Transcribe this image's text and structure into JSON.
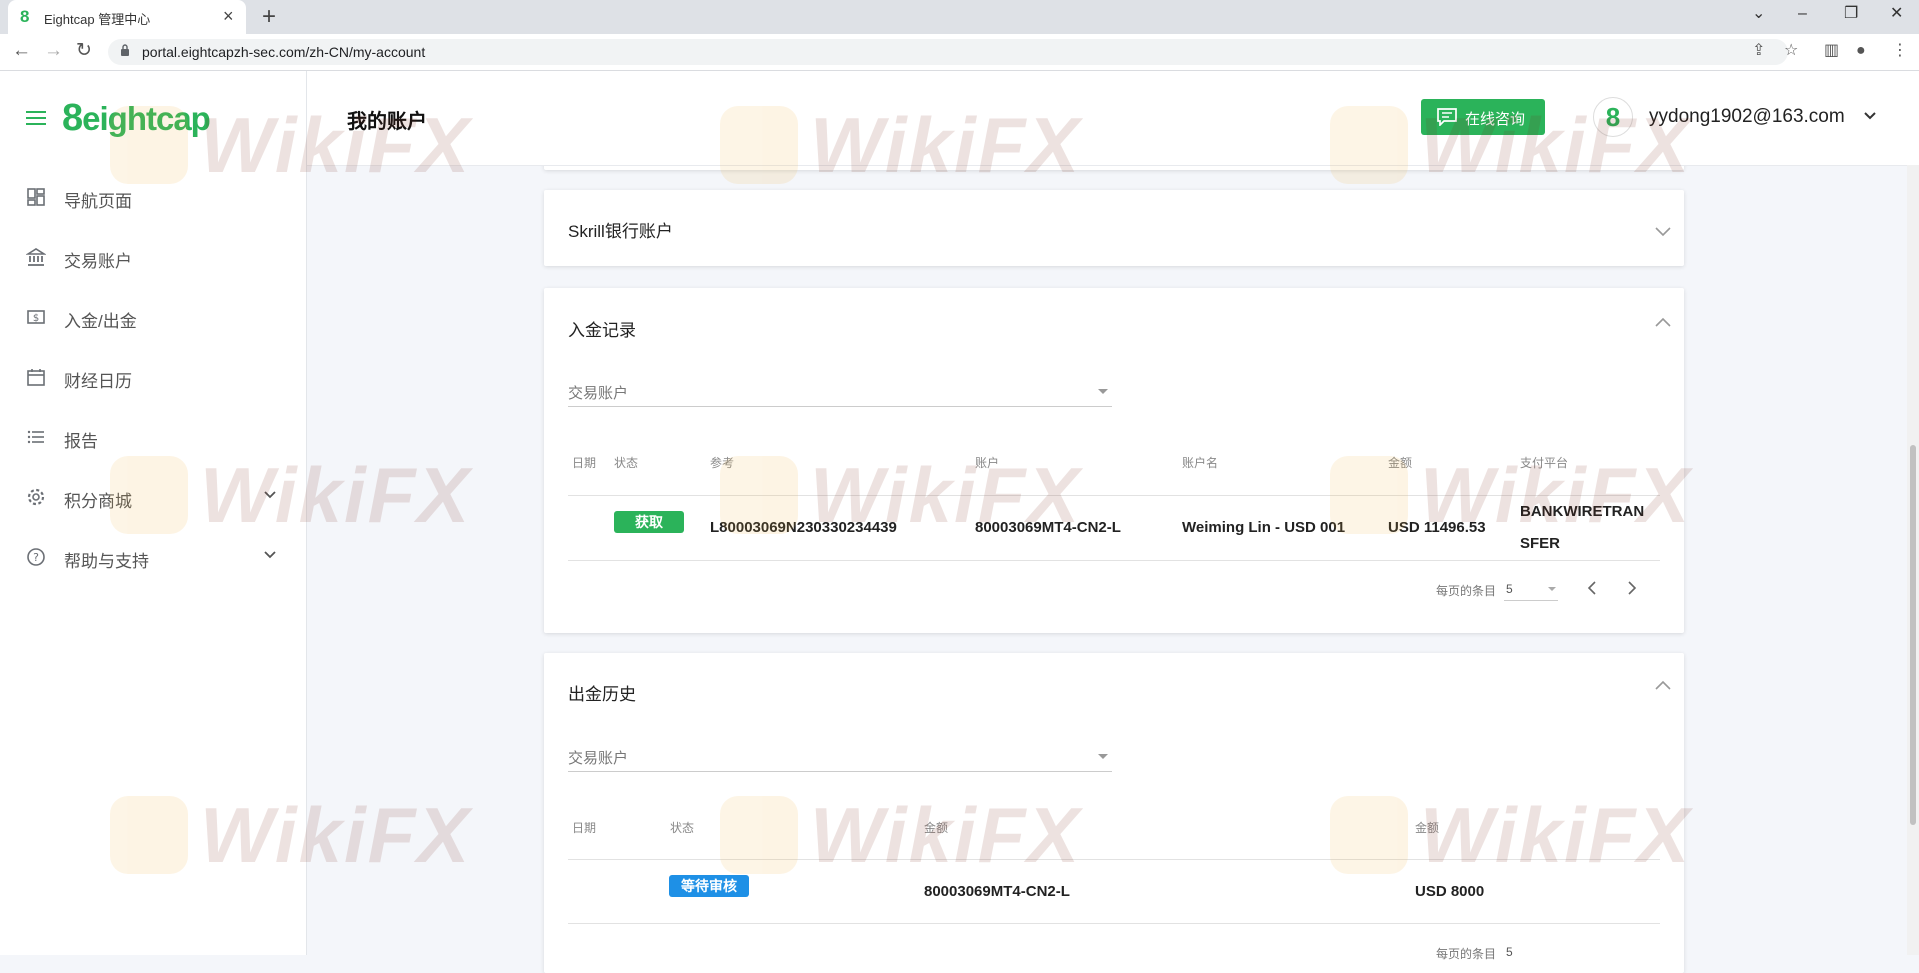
{
  "browser": {
    "tab_title": "Eightcap 管理中心",
    "url": "portal.eightcapzh-sec.com/zh-CN/my-account"
  },
  "brand": {
    "logo_text": "eightcap",
    "logo_digit": "8",
    "accent": "#2bb35a"
  },
  "sidebar": {
    "items": [
      {
        "label": "导航页面",
        "icon": "dashboard-grid-icon"
      },
      {
        "label": "交易账户",
        "icon": "bank-icon"
      },
      {
        "label": "入金/出金",
        "icon": "money-icon"
      },
      {
        "label": "财经日历",
        "icon": "calendar-icon"
      },
      {
        "label": "报告",
        "icon": "list-icon"
      },
      {
        "label": "积分商城",
        "icon": "gear-icon",
        "expandable": true
      },
      {
        "label": "帮助与支持",
        "icon": "help-icon",
        "expandable": true
      }
    ]
  },
  "header": {
    "title": "我的账户",
    "chat_label": "在线咨询",
    "avatar_glyph": "8",
    "user_email": "yydong1902@163.com"
  },
  "skrill": {
    "title": "Skrill银行账户"
  },
  "deposits": {
    "title": "入金记录",
    "select_placeholder": "交易账户",
    "columns": [
      "日期",
      "状态",
      "参考",
      "账户",
      "账户名",
      "金额",
      "支付平台"
    ],
    "row": {
      "date": "",
      "status": "获取",
      "reference": "L80003069N230330234439",
      "account": "80003069MT4-CN2-L",
      "account_name": "Weiming Lin - USD 001",
      "amount": "USD 11496.53",
      "platform_line1": "BANKWIRETRAN",
      "platform_line2": "SFER"
    },
    "pager": {
      "label": "每页的条目",
      "value": "5"
    }
  },
  "withdrawals": {
    "title": "出金历史",
    "select_placeholder": "交易账户",
    "columns": [
      "日期",
      "状态",
      "金额",
      "金额"
    ],
    "row": {
      "date": "",
      "status": "等待审核",
      "account": "80003069MT4-CN2-L",
      "amount": "USD 8000"
    },
    "pager": {
      "label": "每页的条目",
      "value": "5"
    }
  },
  "colors": {
    "status_green": "#2bb35a",
    "status_blue": "#1e90e6"
  },
  "watermark": {
    "text": "WikiFX"
  }
}
